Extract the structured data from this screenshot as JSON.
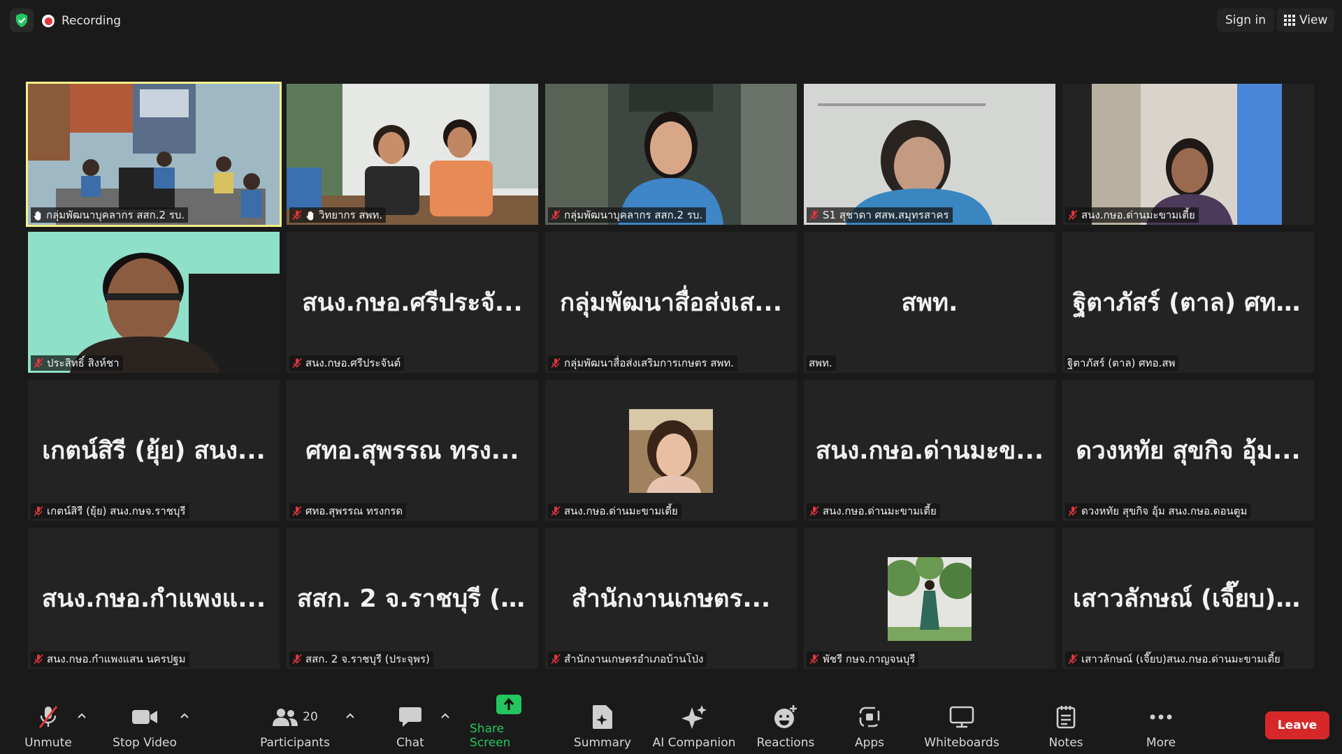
{
  "topbar": {
    "recording": "Recording",
    "sign_in": "Sign in",
    "view": "View"
  },
  "tiles": [
    {
      "label": "กลุ่มพัฒนาบุคลากร สสก.2 รบ.",
      "hand": true,
      "muted": false,
      "active": true
    },
    {
      "label": "วิทยากร สพท.",
      "hand": true,
      "muted": true
    },
    {
      "label": "กลุ่มพัฒนาบุคลากร สสก.2 รบ.",
      "muted": true
    },
    {
      "label": "S1 สุชาดา ศสพ.สมุทรสาคร",
      "muted": true
    },
    {
      "label": "สนง.กษอ.ด่านมะขามเตี้ย",
      "muted": true
    },
    {
      "label": "ประสิทธิ์ สิงห์ชา",
      "muted": true
    },
    {
      "big": "สนง.กษอ.ศรีประจั...",
      "label": "สนง.กษอ.ศรีประจันต์",
      "muted": true
    },
    {
      "big": "กลุ่มพัฒนาสื่อส่งเส...",
      "label": "กลุ่มพัฒนาสื่อส่งเสริมการเกษตร สพท.",
      "muted": true
    },
    {
      "big": "สพท.",
      "label": "สพท.",
      "muted": false
    },
    {
      "big": "ฐิตาภัสร์ (ตาล) ศท...",
      "label": "ฐิตาภัสร์ (ตาล) ศทอ.สพ",
      "muted": false
    },
    {
      "big": "เกตน์สิรี (ยุ้ย) สนง...",
      "label": "เกตน์สิรี (ยุ้ย) สนง.กษจ.ราชบุรี",
      "muted": true
    },
    {
      "big": "ศทอ.สุพรรณ ทรง...",
      "label": "ศทอ.สุพรรณ ทรงกรด",
      "muted": true
    },
    {
      "label": "สนง.กษอ.ด่านมะขามเตี้ย",
      "muted": true,
      "avatar": "woman-portrait"
    },
    {
      "big": "สนง.กษอ.ด่านมะข...",
      "label": "สนง.กษอ.ด่านมะขามเตี้ย",
      "muted": true
    },
    {
      "big": "ดวงหทัย สุขกิจ อุ้ม...",
      "label": "ดวงหทัย สุขกิจ อุ้ม สนง.กษอ.ดอนตูม",
      "muted": true
    },
    {
      "big": "สนง.กษอ.กำแพงแ...",
      "label": "สนง.กษอ.กำแพงแสน นครปฐม",
      "muted": true
    },
    {
      "big": "สสก. 2 จ.ราชบุรี (...",
      "label": "สสก. 2 จ.ราชบุรี (ประจุพร)",
      "muted": true
    },
    {
      "big": "สำนักงานเกษตร...",
      "label": "สำนักงานเกษตรอำเภอบ้านโป่ง",
      "muted": true
    },
    {
      "label": "พัชรี กษจ.กาญจนบุรี",
      "muted": true,
      "avatar": "woman-green-dress"
    },
    {
      "big": "เสาวลักษณ์ (เจี๊ยบ)...",
      "label": "เสาวลักษณ์ (เจี๊ยบ)สนง.กษอ.ด่านมะขามเตี้ย",
      "muted": true
    }
  ],
  "toolbar": {
    "unmute": "Unmute",
    "stop_video": "Stop Video",
    "participants": "Participants",
    "participants_count": "20",
    "chat": "Chat",
    "share_screen": "Share Screen",
    "summary": "Summary",
    "ai_companion": "AI Companion",
    "reactions": "Reactions",
    "apps": "Apps",
    "whiteboards": "Whiteboards",
    "notes": "Notes",
    "more": "More",
    "leave": "Leave"
  },
  "colors": {
    "share_green": "#22c55e",
    "leave_red": "#d62828",
    "active_border": "#f4f08a",
    "mute_red": "#e0373c"
  }
}
